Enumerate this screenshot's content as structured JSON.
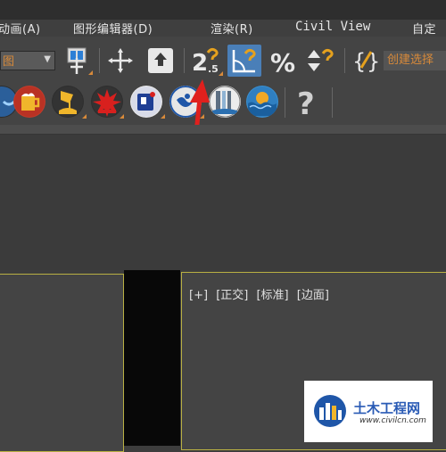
{
  "menubar": {
    "items": [
      {
        "label": "动画(A)"
      },
      {
        "label": "图形编辑器(D)"
      },
      {
        "label": "渲染(R)"
      },
      {
        "label": "Civil View"
      },
      {
        "label": "自定"
      }
    ]
  },
  "toolbar": {
    "dropdown_value": "图",
    "selection_set_label": "创建选择"
  },
  "viewport": {
    "label_parts": [
      "[+]",
      "[正交]",
      "[标准]",
      "[边面]"
    ]
  },
  "watermark": {
    "title": "土木工程网",
    "url": "www.civilcn.com"
  },
  "colors": {
    "accent_orange": "#d88a3a",
    "active_blue": "#4a7fb8",
    "viewport_border": "#b9b043",
    "arrow_red": "#e0201d"
  }
}
